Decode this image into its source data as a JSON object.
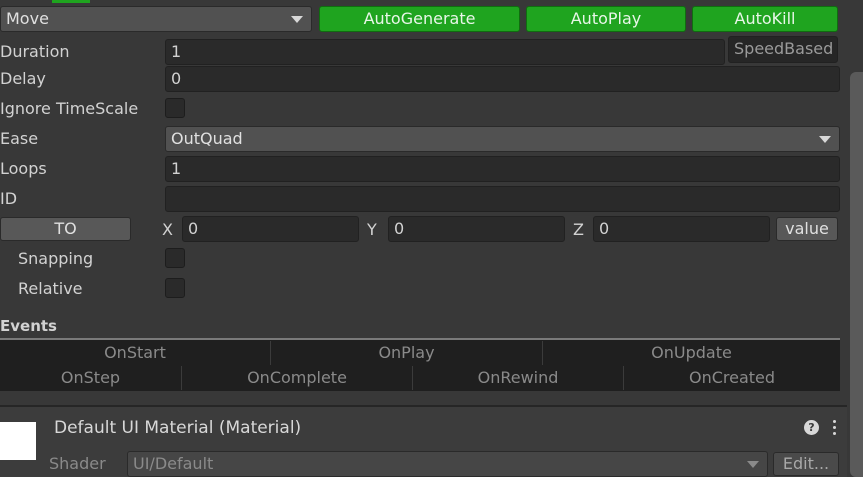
{
  "top": {
    "tween_type": "Move",
    "buttons": [
      "AutoGenerate",
      "AutoPlay",
      "AutoKill"
    ]
  },
  "fields": {
    "duration_label": "Duration",
    "duration_value": "1",
    "speed_based_label": "SpeedBased",
    "delay_label": "Delay",
    "delay_value": "0",
    "ignore_timescale_label": "Ignore TimeScale",
    "ease_label": "Ease",
    "ease_value": "OutQuad",
    "loops_label": "Loops",
    "loops_value": "1",
    "id_label": "ID",
    "id_value": ""
  },
  "target": {
    "to_button": "TO",
    "x_label": "X",
    "x_value": "0",
    "y_label": "Y",
    "y_value": "0",
    "z_label": "Z",
    "z_value": "0",
    "value_button": "value",
    "snapping_label": "Snapping",
    "relative_label": "Relative"
  },
  "events": {
    "title": "Events",
    "row1": [
      "OnStart",
      "OnPlay",
      "OnUpdate"
    ],
    "row2": [
      "OnStep",
      "OnComplete",
      "OnRewind",
      "OnCreated"
    ]
  },
  "material": {
    "title": "Default UI Material (Material)",
    "shader_label": "Shader",
    "shader_value": "UI/Default",
    "edit_button": "Edit...",
    "help_icon": "question-icon",
    "menu_icon": "kebab-menu-icon"
  },
  "colors": {
    "panel": "#383838",
    "field": "#2a2a2a",
    "green_button": "#1fa41f",
    "gray_button": "#585858"
  }
}
